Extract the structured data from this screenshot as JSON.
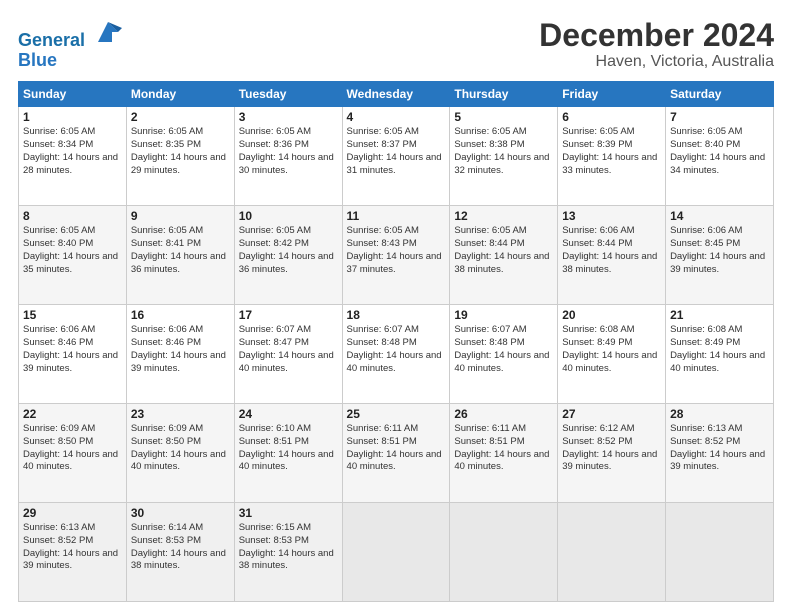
{
  "header": {
    "logo_line1": "General",
    "logo_line2": "Blue",
    "month_title": "December 2024",
    "location": "Haven, Victoria, Australia"
  },
  "weekdays": [
    "Sunday",
    "Monday",
    "Tuesday",
    "Wednesday",
    "Thursday",
    "Friday",
    "Saturday"
  ],
  "weeks": [
    [
      {
        "day": "1",
        "sunrise": "6:05 AM",
        "sunset": "8:34 PM",
        "daylight": "14 hours and 28 minutes."
      },
      {
        "day": "2",
        "sunrise": "6:05 AM",
        "sunset": "8:35 PM",
        "daylight": "14 hours and 29 minutes."
      },
      {
        "day": "3",
        "sunrise": "6:05 AM",
        "sunset": "8:36 PM",
        "daylight": "14 hours and 30 minutes."
      },
      {
        "day": "4",
        "sunrise": "6:05 AM",
        "sunset": "8:37 PM",
        "daylight": "14 hours and 31 minutes."
      },
      {
        "day": "5",
        "sunrise": "6:05 AM",
        "sunset": "8:38 PM",
        "daylight": "14 hours and 32 minutes."
      },
      {
        "day": "6",
        "sunrise": "6:05 AM",
        "sunset": "8:39 PM",
        "daylight": "14 hours and 33 minutes."
      },
      {
        "day": "7",
        "sunrise": "6:05 AM",
        "sunset": "8:40 PM",
        "daylight": "14 hours and 34 minutes."
      }
    ],
    [
      {
        "day": "8",
        "sunrise": "6:05 AM",
        "sunset": "8:40 PM",
        "daylight": "14 hours and 35 minutes."
      },
      {
        "day": "9",
        "sunrise": "6:05 AM",
        "sunset": "8:41 PM",
        "daylight": "14 hours and 36 minutes."
      },
      {
        "day": "10",
        "sunrise": "6:05 AM",
        "sunset": "8:42 PM",
        "daylight": "14 hours and 36 minutes."
      },
      {
        "day": "11",
        "sunrise": "6:05 AM",
        "sunset": "8:43 PM",
        "daylight": "14 hours and 37 minutes."
      },
      {
        "day": "12",
        "sunrise": "6:05 AM",
        "sunset": "8:44 PM",
        "daylight": "14 hours and 38 minutes."
      },
      {
        "day": "13",
        "sunrise": "6:06 AM",
        "sunset": "8:44 PM",
        "daylight": "14 hours and 38 minutes."
      },
      {
        "day": "14",
        "sunrise": "6:06 AM",
        "sunset": "8:45 PM",
        "daylight": "14 hours and 39 minutes."
      }
    ],
    [
      {
        "day": "15",
        "sunrise": "6:06 AM",
        "sunset": "8:46 PM",
        "daylight": "14 hours and 39 minutes."
      },
      {
        "day": "16",
        "sunrise": "6:06 AM",
        "sunset": "8:46 PM",
        "daylight": "14 hours and 39 minutes."
      },
      {
        "day": "17",
        "sunrise": "6:07 AM",
        "sunset": "8:47 PM",
        "daylight": "14 hours and 40 minutes."
      },
      {
        "day": "18",
        "sunrise": "6:07 AM",
        "sunset": "8:48 PM",
        "daylight": "14 hours and 40 minutes."
      },
      {
        "day": "19",
        "sunrise": "6:07 AM",
        "sunset": "8:48 PM",
        "daylight": "14 hours and 40 minutes."
      },
      {
        "day": "20",
        "sunrise": "6:08 AM",
        "sunset": "8:49 PM",
        "daylight": "14 hours and 40 minutes."
      },
      {
        "day": "21",
        "sunrise": "6:08 AM",
        "sunset": "8:49 PM",
        "daylight": "14 hours and 40 minutes."
      }
    ],
    [
      {
        "day": "22",
        "sunrise": "6:09 AM",
        "sunset": "8:50 PM",
        "daylight": "14 hours and 40 minutes."
      },
      {
        "day": "23",
        "sunrise": "6:09 AM",
        "sunset": "8:50 PM",
        "daylight": "14 hours and 40 minutes."
      },
      {
        "day": "24",
        "sunrise": "6:10 AM",
        "sunset": "8:51 PM",
        "daylight": "14 hours and 40 minutes."
      },
      {
        "day": "25",
        "sunrise": "6:11 AM",
        "sunset": "8:51 PM",
        "daylight": "14 hours and 40 minutes."
      },
      {
        "day": "26",
        "sunrise": "6:11 AM",
        "sunset": "8:51 PM",
        "daylight": "14 hours and 40 minutes."
      },
      {
        "day": "27",
        "sunrise": "6:12 AM",
        "sunset": "8:52 PM",
        "daylight": "14 hours and 39 minutes."
      },
      {
        "day": "28",
        "sunrise": "6:13 AM",
        "sunset": "8:52 PM",
        "daylight": "14 hours and 39 minutes."
      }
    ],
    [
      {
        "day": "29",
        "sunrise": "6:13 AM",
        "sunset": "8:52 PM",
        "daylight": "14 hours and 39 minutes."
      },
      {
        "day": "30",
        "sunrise": "6:14 AM",
        "sunset": "8:53 PM",
        "daylight": "14 hours and 38 minutes."
      },
      {
        "day": "31",
        "sunrise": "6:15 AM",
        "sunset": "8:53 PM",
        "daylight": "14 hours and 38 minutes."
      },
      null,
      null,
      null,
      null
    ]
  ]
}
